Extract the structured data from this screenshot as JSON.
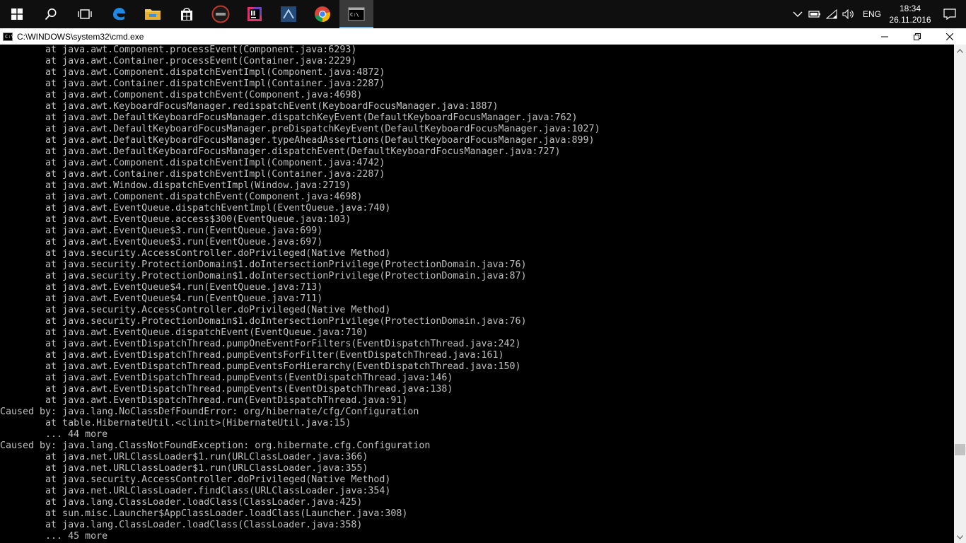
{
  "taskbar": {
    "apps": [
      {
        "name": "start",
        "icon": "windows-logo-icon"
      },
      {
        "name": "search",
        "icon": "search-icon"
      },
      {
        "name": "task-view",
        "icon": "task-view-icon"
      },
      {
        "name": "edge",
        "icon": "edge-icon"
      },
      {
        "name": "file-explorer",
        "icon": "folder-icon"
      },
      {
        "name": "store",
        "icon": "store-icon"
      },
      {
        "name": "asus",
        "icon": "asus-icon"
      },
      {
        "name": "intellij",
        "icon": "intellij-icon"
      },
      {
        "name": "workbench",
        "icon": "workbench-icon"
      },
      {
        "name": "chrome",
        "icon": "chrome-icon"
      },
      {
        "name": "cmd",
        "icon": "cmd-icon"
      }
    ],
    "tray": {
      "language": "ENG",
      "time": "18:34",
      "date": "26.11.2016"
    }
  },
  "window": {
    "title": "C:\\WINDOWS\\system32\\cmd.exe",
    "title_icon_glyph": "C:\\",
    "controls": {
      "minimize": "—",
      "maximize": "❐",
      "close": "✕"
    }
  },
  "console": {
    "text_color": "#c0c0c0",
    "background": "#000000",
    "lines": [
      "        at java.awt.Component.processEvent(Component.java:6293)",
      "        at java.awt.Container.processEvent(Container.java:2229)",
      "        at java.awt.Component.dispatchEventImpl(Component.java:4872)",
      "        at java.awt.Container.dispatchEventImpl(Container.java:2287)",
      "        at java.awt.Component.dispatchEvent(Component.java:4698)",
      "        at java.awt.KeyboardFocusManager.redispatchEvent(KeyboardFocusManager.java:1887)",
      "        at java.awt.DefaultKeyboardFocusManager.dispatchKeyEvent(DefaultKeyboardFocusManager.java:762)",
      "        at java.awt.DefaultKeyboardFocusManager.preDispatchKeyEvent(DefaultKeyboardFocusManager.java:1027)",
      "        at java.awt.DefaultKeyboardFocusManager.typeAheadAssertions(DefaultKeyboardFocusManager.java:899)",
      "        at java.awt.DefaultKeyboardFocusManager.dispatchEvent(DefaultKeyboardFocusManager.java:727)",
      "        at java.awt.Component.dispatchEventImpl(Component.java:4742)",
      "        at java.awt.Container.dispatchEventImpl(Container.java:2287)",
      "        at java.awt.Window.dispatchEventImpl(Window.java:2719)",
      "        at java.awt.Component.dispatchEvent(Component.java:4698)",
      "        at java.awt.EventQueue.dispatchEventImpl(EventQueue.java:740)",
      "        at java.awt.EventQueue.access$300(EventQueue.java:103)",
      "        at java.awt.EventQueue$3.run(EventQueue.java:699)",
      "        at java.awt.EventQueue$3.run(EventQueue.java:697)",
      "        at java.security.AccessController.doPrivileged(Native Method)",
      "        at java.security.ProtectionDomain$1.doIntersectionPrivilege(ProtectionDomain.java:76)",
      "        at java.security.ProtectionDomain$1.doIntersectionPrivilege(ProtectionDomain.java:87)",
      "        at java.awt.EventQueue$4.run(EventQueue.java:713)",
      "        at java.awt.EventQueue$4.run(EventQueue.java:711)",
      "        at java.security.AccessController.doPrivileged(Native Method)",
      "        at java.security.ProtectionDomain$1.doIntersectionPrivilege(ProtectionDomain.java:76)",
      "        at java.awt.EventQueue.dispatchEvent(EventQueue.java:710)",
      "        at java.awt.EventDispatchThread.pumpOneEventForFilters(EventDispatchThread.java:242)",
      "        at java.awt.EventDispatchThread.pumpEventsForFilter(EventDispatchThread.java:161)",
      "        at java.awt.EventDispatchThread.pumpEventsForHierarchy(EventDispatchThread.java:150)",
      "        at java.awt.EventDispatchThread.pumpEvents(EventDispatchThread.java:146)",
      "        at java.awt.EventDispatchThread.pumpEvents(EventDispatchThread.java:138)",
      "        at java.awt.EventDispatchThread.run(EventDispatchThread.java:91)",
      "Caused by: java.lang.NoClassDefFoundError: org/hibernate/cfg/Configuration",
      "        at table.HibernateUtil.<clinit>(HibernateUtil.java:15)",
      "        ... 44 more",
      "Caused by: java.lang.ClassNotFoundException: org.hibernate.cfg.Configuration",
      "        at java.net.URLClassLoader$1.run(URLClassLoader.java:366)",
      "        at java.net.URLClassLoader$1.run(URLClassLoader.java:355)",
      "        at java.security.AccessController.doPrivileged(Native Method)",
      "        at java.net.URLClassLoader.findClass(URLClassLoader.java:354)",
      "        at java.lang.ClassLoader.loadClass(ClassLoader.java:425)",
      "        at sun.misc.Launcher$AppClassLoader.loadClass(Launcher.java:308)",
      "        at java.lang.ClassLoader.loadClass(ClassLoader.java:358)",
      "        ... 45 more"
    ]
  }
}
